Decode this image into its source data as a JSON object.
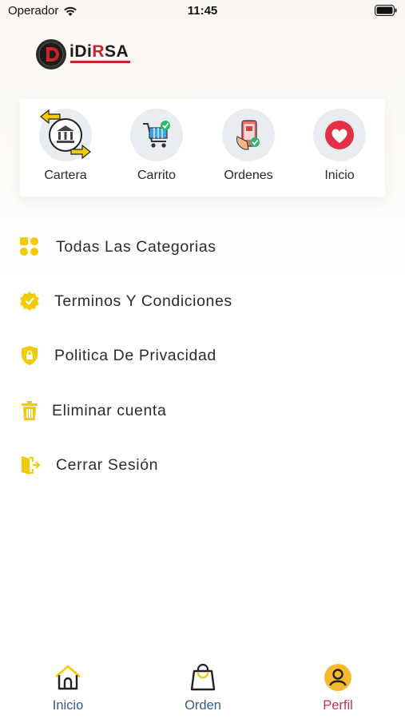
{
  "status_bar": {
    "carrier": "Operador",
    "time": "11:45"
  },
  "logo": {
    "brand_black": "iDi",
    "brand_red": "R",
    "brand_rest": "SA"
  },
  "shortcuts": [
    {
      "label": "Cartera",
      "icon": "bank-exchange-icon"
    },
    {
      "label": "Carrito",
      "icon": "shopping-cart-icon"
    },
    {
      "label": "Ordenes",
      "icon": "phone-order-icon"
    },
    {
      "label": "Inicio",
      "icon": "heart-icon"
    }
  ],
  "menu": [
    {
      "label": "Todas Las Categorias",
      "icon": "grid-icon"
    },
    {
      "label": "Terminos Y Condiciones",
      "icon": "badge-icon"
    },
    {
      "label": "Politica De Privacidad",
      "icon": "shield-lock-icon"
    },
    {
      "label": "Eliminar cuenta",
      "icon": "trash-icon"
    },
    {
      "label": "Cerrar Sesión",
      "icon": "logout-door-icon"
    }
  ],
  "bottom_nav": [
    {
      "label": "Inicio",
      "icon": "home-icon",
      "color": "#2d5f8b"
    },
    {
      "label": "Orden",
      "icon": "bag-icon",
      "color": "#2d5f8b"
    },
    {
      "label": "Perfil",
      "icon": "user-icon",
      "color": "#c8324a",
      "active": true
    }
  ],
  "colors": {
    "accent_yellow": "#f2cc00",
    "active_red": "#c8324a",
    "nav_blue": "#2d5f8b"
  }
}
